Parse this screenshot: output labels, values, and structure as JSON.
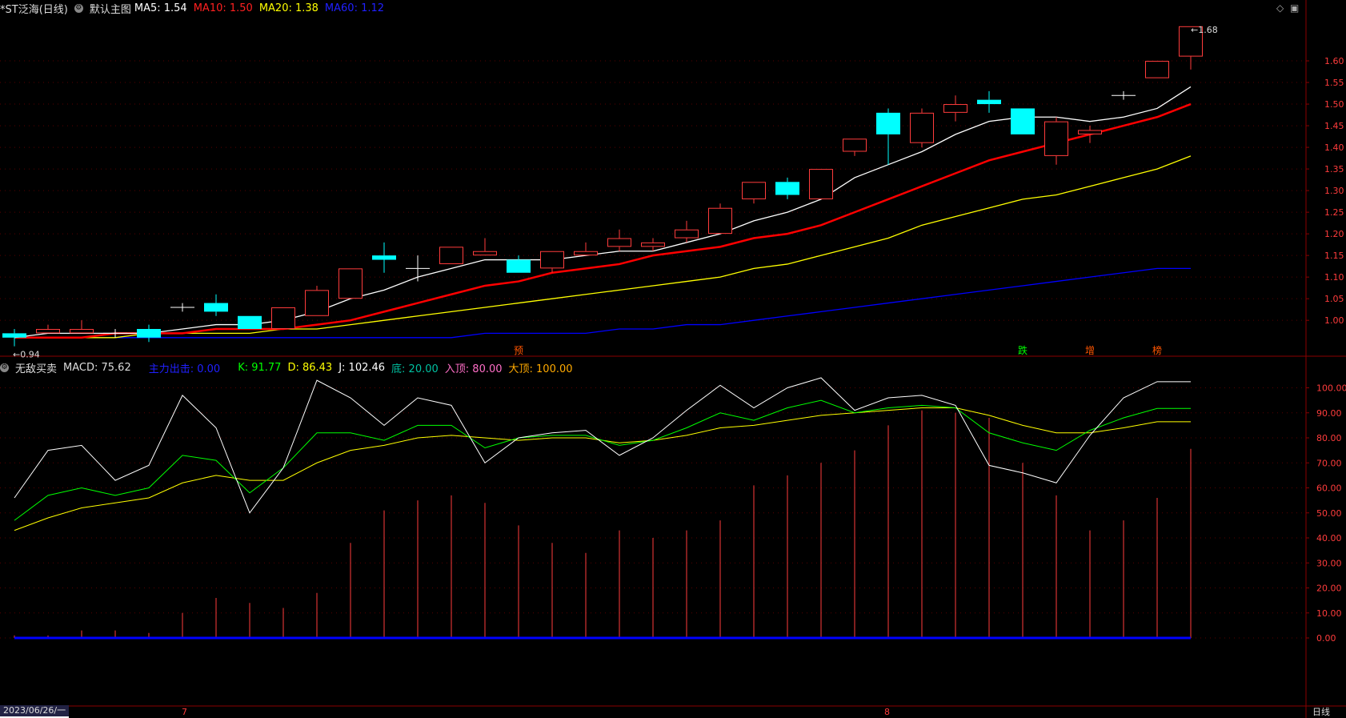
{
  "header": {
    "symbol": "*ST泛海(日线)",
    "main_label": "默认主图",
    "ma5": "MA5: 1.54",
    "ma10": "MA10: 1.50",
    "ma20": "MA20: 1.38",
    "ma60": "MA60: 1.12"
  },
  "sub_header": {
    "name": "无敌买卖",
    "macd": "MACD: 75.62",
    "zhuli": "主力出击: 0.00",
    "k": "K: 91.77",
    "d": "D: 86.43",
    "j": "J: 102.46",
    "di": "底: 20.00",
    "rudin": "入顶: 80.00",
    "dading": "大顶: 100.00"
  },
  "footer": {
    "date": "2023/06/26/一",
    "month7": "7",
    "month8": "8",
    "period": "日线"
  },
  "colors": {
    "up": "#ff3c3c",
    "down": "#00ffff",
    "ma5": "#ffffff",
    "ma10": "#ff0000",
    "ma20": "#ffff00",
    "ma60": "#0000ff",
    "k": "#00ff00",
    "d": "#ffff00",
    "j": "#ffffff"
  },
  "chart_data": [
    {
      "type": "candlestick",
      "title": "*ST泛海(日线)",
      "ylim": [
        0.93,
        1.7
      ],
      "yticks": [
        "1.00",
        "1.05",
        "1.10",
        "1.15",
        "1.20",
        "1.25",
        "1.30",
        "1.35",
        "1.40",
        "1.45",
        "1.50",
        "1.55",
        "1.60"
      ],
      "candles": [
        {
          "o": 0.97,
          "c": 0.96,
          "h": 0.98,
          "l": 0.94
        },
        {
          "o": 0.97,
          "c": 0.98,
          "h": 0.99,
          "l": 0.97
        },
        {
          "o": 0.97,
          "c": 0.98,
          "h": 1.0,
          "l": 0.97
        },
        {
          "o": 0.97,
          "c": 0.97,
          "h": 0.98,
          "l": 0.96
        },
        {
          "o": 0.98,
          "c": 0.96,
          "h": 0.99,
          "l": 0.95
        },
        {
          "o": 1.03,
          "c": 1.03,
          "h": 1.04,
          "l": 1.02
        },
        {
          "o": 1.04,
          "c": 1.02,
          "h": 1.06,
          "l": 1.01
        },
        {
          "o": 1.01,
          "c": 0.98,
          "h": 1.01,
          "l": 0.98
        },
        {
          "o": 0.98,
          "c": 1.03,
          "h": 1.03,
          "l": 0.98
        },
        {
          "o": 1.01,
          "c": 1.07,
          "h": 1.08,
          "l": 1.01
        },
        {
          "o": 1.05,
          "c": 1.12,
          "h": 1.12,
          "l": 1.05
        },
        {
          "o": 1.15,
          "c": 1.14,
          "h": 1.18,
          "l": 1.11
        },
        {
          "o": 1.12,
          "c": 1.12,
          "h": 1.15,
          "l": 1.09
        },
        {
          "o": 1.13,
          "c": 1.17,
          "h": 1.17,
          "l": 1.13
        },
        {
          "o": 1.15,
          "c": 1.16,
          "h": 1.19,
          "l": 1.15
        },
        {
          "o": 1.14,
          "c": 1.11,
          "h": 1.15,
          "l": 1.11
        },
        {
          "o": 1.12,
          "c": 1.16,
          "h": 1.16,
          "l": 1.11
        },
        {
          "o": 1.15,
          "c": 1.16,
          "h": 1.18,
          "l": 1.15
        },
        {
          "o": 1.17,
          "c": 1.19,
          "h": 1.21,
          "l": 1.16
        },
        {
          "o": 1.17,
          "c": 1.18,
          "h": 1.19,
          "l": 1.16
        },
        {
          "o": 1.19,
          "c": 1.21,
          "h": 1.23,
          "l": 1.18
        },
        {
          "o": 1.2,
          "c": 1.26,
          "h": 1.27,
          "l": 1.2
        },
        {
          "o": 1.28,
          "c": 1.32,
          "h": 1.32,
          "l": 1.27
        },
        {
          "o": 1.32,
          "c": 1.29,
          "h": 1.33,
          "l": 1.28
        },
        {
          "o": 1.28,
          "c": 1.35,
          "h": 1.35,
          "l": 1.28
        },
        {
          "o": 1.39,
          "c": 1.42,
          "h": 1.42,
          "l": 1.38
        },
        {
          "o": 1.48,
          "c": 1.43,
          "h": 1.49,
          "l": 1.36
        },
        {
          "o": 1.41,
          "c": 1.48,
          "h": 1.49,
          "l": 1.4
        },
        {
          "o": 1.48,
          "c": 1.5,
          "h": 1.52,
          "l": 1.46
        },
        {
          "o": 1.51,
          "c": 1.5,
          "h": 1.53,
          "l": 1.48
        },
        {
          "o": 1.49,
          "c": 1.43,
          "h": 1.49,
          "l": 1.43
        },
        {
          "o": 1.38,
          "c": 1.46,
          "h": 1.47,
          "l": 1.36
        },
        {
          "o": 1.43,
          "c": 1.44,
          "h": 1.45,
          "l": 1.41
        },
        {
          "o": 1.52,
          "c": 1.52,
          "h": 1.53,
          "l": 1.51
        },
        {
          "o": 1.56,
          "c": 1.6,
          "h": 1.6,
          "l": 1.56
        },
        {
          "o": 1.61,
          "c": 1.68,
          "h": 1.68,
          "l": 1.58
        }
      ],
      "ma5": [
        0.96,
        0.97,
        0.97,
        0.97,
        0.97,
        0.98,
        0.99,
        0.99,
        1.0,
        1.02,
        1.05,
        1.07,
        1.1,
        1.12,
        1.14,
        1.14,
        1.14,
        1.15,
        1.16,
        1.16,
        1.18,
        1.2,
        1.23,
        1.25,
        1.28,
        1.33,
        1.36,
        1.39,
        1.43,
        1.46,
        1.47,
        1.47,
        1.46,
        1.47,
        1.49,
        1.54
      ],
      "ma10": [
        0.96,
        0.96,
        0.96,
        0.97,
        0.97,
        0.97,
        0.98,
        0.98,
        0.98,
        0.99,
        1.0,
        1.02,
        1.04,
        1.06,
        1.08,
        1.09,
        1.11,
        1.12,
        1.13,
        1.15,
        1.16,
        1.17,
        1.19,
        1.2,
        1.22,
        1.25,
        1.28,
        1.31,
        1.34,
        1.37,
        1.39,
        1.41,
        1.43,
        1.45,
        1.47,
        1.5
      ],
      "ma20": [
        0.96,
        0.96,
        0.96,
        0.96,
        0.97,
        0.97,
        0.97,
        0.97,
        0.98,
        0.98,
        0.99,
        1.0,
        1.01,
        1.02,
        1.03,
        1.04,
        1.05,
        1.06,
        1.07,
        1.08,
        1.09,
        1.1,
        1.12,
        1.13,
        1.15,
        1.17,
        1.19,
        1.22,
        1.24,
        1.26,
        1.28,
        1.29,
        1.31,
        1.33,
        1.35,
        1.38
      ],
      "ma60": [
        0.96,
        0.96,
        0.96,
        0.96,
        0.96,
        0.96,
        0.96,
        0.96,
        0.96,
        0.96,
        0.96,
        0.96,
        0.96,
        0.96,
        0.97,
        0.97,
        0.97,
        0.97,
        0.98,
        0.98,
        0.99,
        0.99,
        1.0,
        1.01,
        1.02,
        1.03,
        1.04,
        1.05,
        1.06,
        1.07,
        1.08,
        1.09,
        1.1,
        1.11,
        1.12,
        1.12
      ],
      "annotations": [
        {
          "text": "1.68",
          "index": 35,
          "value": 1.68
        },
        {
          "text": "0.94",
          "index": 0,
          "value": 0.94
        }
      ],
      "signals": [
        {
          "text": "预",
          "index": 15,
          "color": "#ff5500"
        },
        {
          "text": "跌",
          "index": 30,
          "color": "#00ff00"
        },
        {
          "text": "增",
          "index": 32,
          "color": "#ff5500"
        },
        {
          "text": "榜",
          "index": 34,
          "color": "#ff5500"
        }
      ]
    },
    {
      "type": "line",
      "title": "无敌买卖",
      "ylim": [
        0,
        105
      ],
      "yticks": [
        "0.00",
        "10.00",
        "20.00",
        "30.00",
        "40.00",
        "50.00",
        "60.00",
        "70.00",
        "80.00",
        "90.00",
        "100.00"
      ],
      "macd": [
        1,
        1,
        3,
        3,
        2,
        10,
        16,
        14,
        12,
        18,
        38,
        51,
        55,
        57,
        54,
        45,
        38,
        34,
        43,
        40,
        43,
        47,
        61,
        65,
        70,
        75,
        85,
        91,
        90,
        88,
        70,
        57,
        43,
        47,
        56,
        75.62
      ],
      "k": [
        47,
        57,
        60,
        57,
        60,
        73,
        71,
        58,
        68,
        82,
        82,
        79,
        85,
        85,
        76,
        80,
        81,
        81,
        77,
        79,
        84,
        90,
        87,
        92,
        95,
        90,
        92,
        93,
        92,
        82,
        78,
        75,
        83,
        88,
        91.77,
        91.77
      ],
      "d": [
        43,
        48,
        52,
        54,
        56,
        62,
        65,
        63,
        63,
        70,
        75,
        77,
        80,
        81,
        80,
        79,
        80,
        80,
        78,
        79,
        81,
        84,
        85,
        87,
        89,
        90,
        91,
        92,
        92,
        89,
        85,
        82,
        82,
        84,
        86.43,
        86.43
      ],
      "j": [
        56,
        75,
        77,
        63,
        69,
        97,
        84,
        50,
        68,
        103,
        96,
        85,
        96,
        93,
        70,
        80,
        82,
        83,
        73,
        80,
        91,
        101,
        92,
        100,
        104,
        91,
        96,
        97,
        93,
        69,
        66,
        62,
        81,
        96,
        102.46,
        102.46
      ]
    }
  ]
}
